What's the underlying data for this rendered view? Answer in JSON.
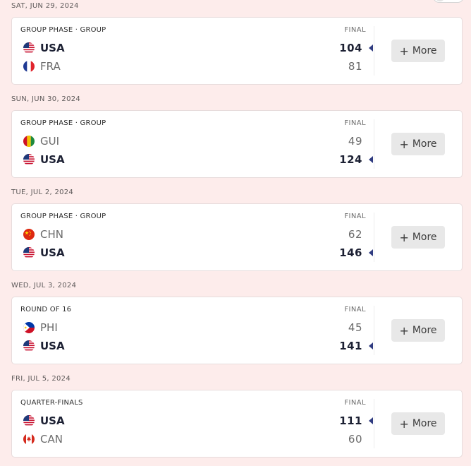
{
  "games": [
    {
      "date": "SAT, JUN 29, 2024",
      "phase": "GROUP PHASE · GROUP",
      "status": "FINAL",
      "more_label": "More",
      "teams": [
        {
          "abbr": "USA",
          "flag": "usa-flag-icon",
          "score": "104",
          "winner": true
        },
        {
          "abbr": "FRA",
          "flag": "france-flag-icon",
          "score": "81",
          "winner": false
        }
      ]
    },
    {
      "date": "SUN, JUN 30, 2024",
      "phase": "GROUP PHASE · GROUP",
      "status": "FINAL",
      "more_label": "More",
      "teams": [
        {
          "abbr": "GUI",
          "flag": "guinea-flag-icon",
          "score": "49",
          "winner": false
        },
        {
          "abbr": "USA",
          "flag": "usa-flag-icon",
          "score": "124",
          "winner": true
        }
      ]
    },
    {
      "date": "TUE, JUL 2, 2024",
      "phase": "GROUP PHASE · GROUP",
      "status": "FINAL",
      "more_label": "More",
      "teams": [
        {
          "abbr": "CHN",
          "flag": "china-flag-icon",
          "score": "62",
          "winner": false
        },
        {
          "abbr": "USA",
          "flag": "usa-flag-icon",
          "score": "146",
          "winner": true
        }
      ]
    },
    {
      "date": "WED, JUL 3, 2024",
      "phase": "ROUND OF 16",
      "status": "FINAL",
      "more_label": "More",
      "teams": [
        {
          "abbr": "PHI",
          "flag": "philippines-flag-icon",
          "score": "45",
          "winner": false
        },
        {
          "abbr": "USA",
          "flag": "usa-flag-icon",
          "score": "141",
          "winner": true
        }
      ]
    },
    {
      "date": "FRI, JUL 5, 2024",
      "phase": "QUARTER-FINALS",
      "status": "FINAL",
      "more_label": "More",
      "teams": [
        {
          "abbr": "USA",
          "flag": "usa-flag-icon",
          "score": "111",
          "winner": true
        },
        {
          "abbr": "CAN",
          "flag": "canada-flag-icon",
          "score": "60",
          "winner": false
        }
      ]
    }
  ]
}
